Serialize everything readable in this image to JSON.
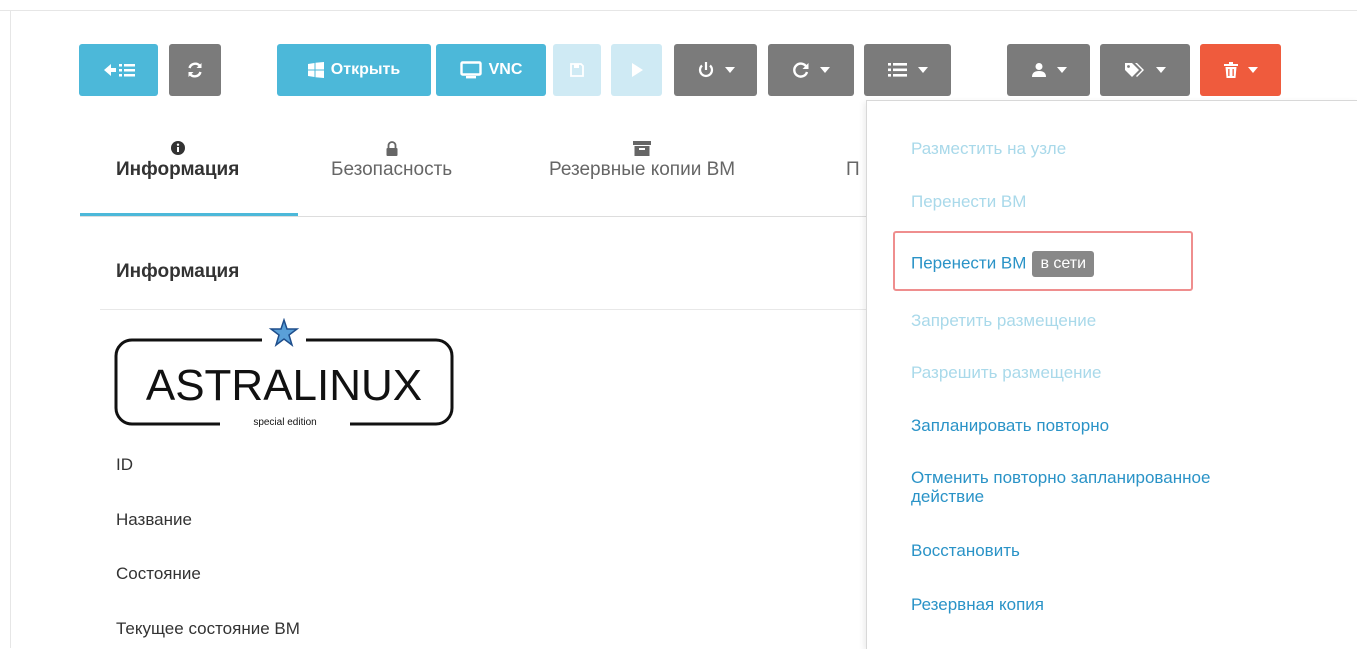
{
  "toolbar": {
    "back_icon": "back-list-icon",
    "refresh_icon": "refresh-icon",
    "open_label": "Открыть",
    "open_icon": "windows-icon",
    "vnc_label": "VNC",
    "vnc_icon": "monitor-icon",
    "save_icon": "save-icon",
    "play_icon": "play-icon",
    "power_icon": "power-icon",
    "reboot_icon": "reload-icon",
    "list_icon": "list-icon",
    "user_icon": "user-icon",
    "tag_icon": "tag-icon",
    "delete_icon": "trash-icon",
    "colors": {
      "info": "#4cb8d9",
      "gray": "#7b7b7b",
      "danger": "#ef5b3d"
    }
  },
  "tabs": [
    {
      "label": "Информация",
      "icon": "info-icon",
      "active": true
    },
    {
      "label": "Безопасность",
      "icon": "lock-icon",
      "active": false
    },
    {
      "label": "Резервные копии ВМ",
      "icon": "archive-icon",
      "active": false
    },
    {
      "label": "П",
      "icon": "",
      "active": false
    }
  ],
  "section": {
    "title": "Информация"
  },
  "logo": {
    "text": "ASTRALINUX",
    "subtext": "special edition"
  },
  "fields": [
    "ID",
    "Название",
    "Состояние",
    "Текущее состояние ВМ"
  ],
  "dropdown": {
    "items": [
      {
        "label": "Разместить на узле",
        "enabled": false
      },
      {
        "label": "Перенести ВМ",
        "enabled": false
      },
      {
        "label": "Перенести ВМ",
        "badge": "в сети",
        "enabled": true,
        "highlighted": true
      },
      {
        "label": "Запретить размещение",
        "enabled": false
      },
      {
        "label": "Разрешить размещение",
        "enabled": false
      },
      {
        "label": "Запланировать повторно",
        "enabled": true
      },
      {
        "label_line1": "Отменить повторно запланированное",
        "label_line2": "действие",
        "enabled": true
      },
      {
        "label": "Восстановить",
        "enabled": true
      },
      {
        "label": "Резервная копия",
        "enabled": true
      }
    ]
  }
}
